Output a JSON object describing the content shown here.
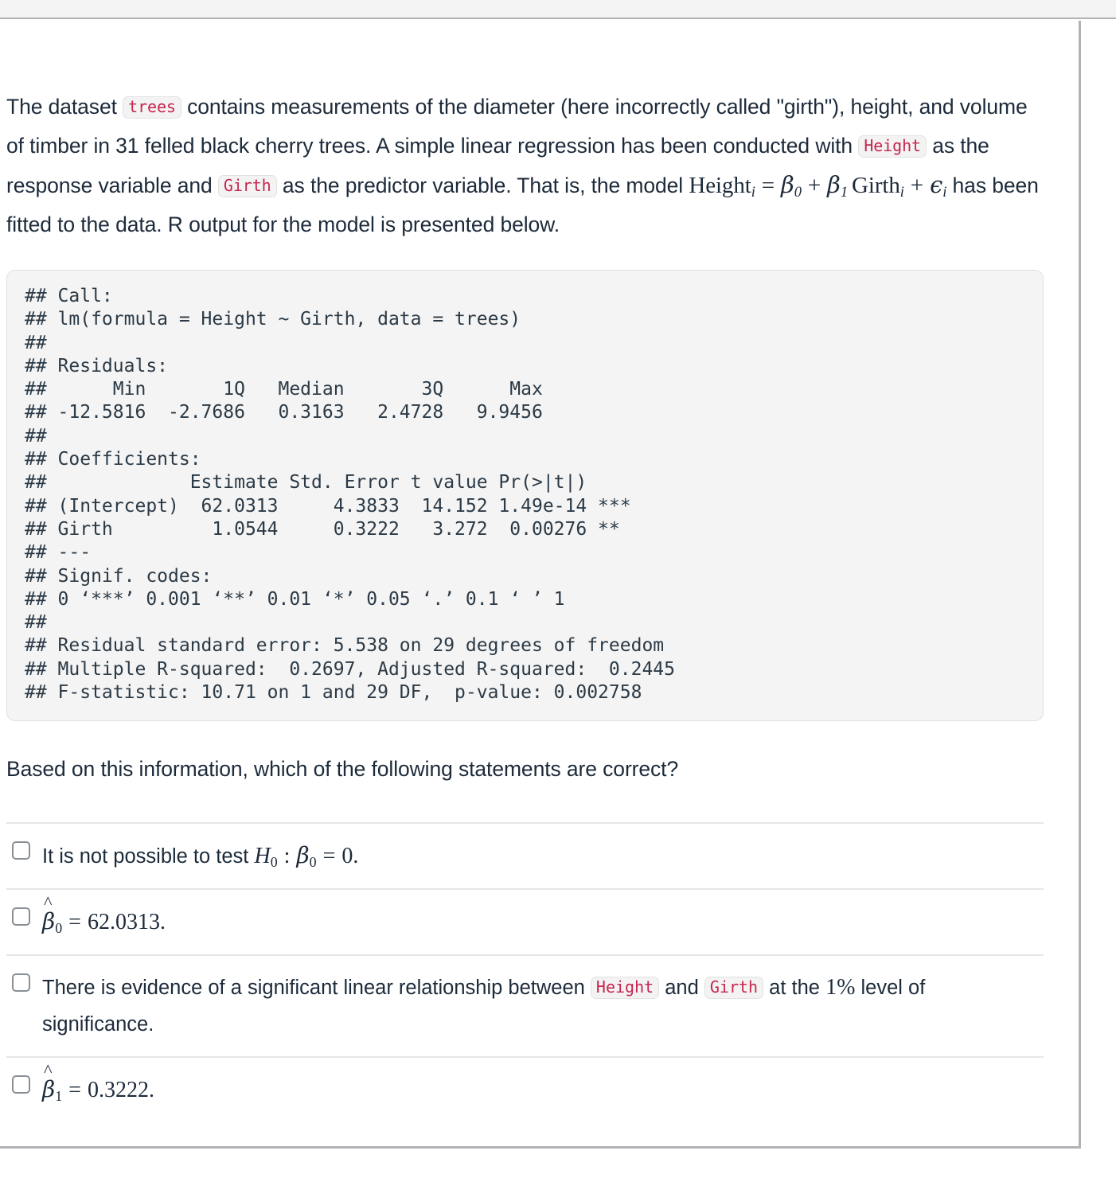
{
  "document": {
    "intro": {
      "seg1": "The dataset ",
      "code_trees": "trees",
      "seg2": " contains measurements of the diameter (here incorrectly called \"girth\"), height, and volume of timber in 31 felled black cherry trees. A simple linear regression has been conducted with ",
      "code_height": "Height",
      "seg3": " as the response variable and ",
      "code_girth": "Girth",
      "seg4": " as the predictor variable. That is, the model ",
      "seg5": " has been fitted to the data. R output for the model is presented below.",
      "model_formula": {
        "lhs": "Height",
        "lhs_sub": "i",
        "equals": "=",
        "beta0": "β",
        "beta0_sub": "0",
        "plus1": "+",
        "beta1": "β",
        "beta1_sub": "1",
        "girth": "Girth",
        "girth_sub": "i",
        "plus2": "+",
        "epsilon": "ϵ",
        "epsilon_sub": "i"
      }
    },
    "r_output": "## Call:\n## lm(formula = Height ~ Girth, data = trees)\n## \n## Residuals:\n##      Min       1Q   Median       3Q      Max \n## -12.5816  -2.7686   0.3163   2.4728   9.9456 \n## \n## Coefficients:\n##             Estimate Std. Error t value Pr(>|t|)    \n## (Intercept)  62.0313     4.3833  14.152 1.49e-14 ***\n## Girth         1.0544     0.3222   3.272  0.00276 ** \n## ---\n## Signif. codes:\n## 0 ‘***’ 0.001 ‘**’ 0.01 ‘*’ 0.05 ‘.’ 0.1 ‘ ’ 1\n## \n## Residual standard error: 5.538 on 29 degrees of freedom\n## Multiple R-squared:  0.2697, Adjusted R-squared:  0.2445 \n## F-statistic: 10.71 on 1 and 29 DF,  p-value: 0.002758",
    "r_output_values": {
      "call": "lm(formula = Height ~ Girth, data = trees)",
      "residuals": {
        "headers": [
          "Min",
          "1Q",
          "Median",
          "3Q",
          "Max"
        ],
        "values": [
          "-12.5816",
          "-2.7686",
          "0.3163",
          "2.4728",
          "9.9456"
        ]
      },
      "coefficients": {
        "headers": [
          "",
          "Estimate",
          "Std. Error",
          "t value",
          "Pr(>|t|)",
          ""
        ],
        "rows": [
          [
            "(Intercept)",
            "62.0313",
            "4.3833",
            "14.152",
            "1.49e-14",
            "***"
          ],
          [
            "Girth",
            "1.0544",
            "0.3222",
            "3.272",
            "0.00276",
            "**"
          ]
        ]
      },
      "signif_codes": "0 ‘***’ 0.001 ‘**’ 0.01 ‘*’ 0.05 ‘.’ 0.1 ‘ ’ 1",
      "residual_standard_error": "5.538",
      "residual_df": "29",
      "multiple_r_squared": "0.2697",
      "adjusted_r_squared": "0.2445",
      "f_statistic": "10.71",
      "f_df1": "1",
      "f_df2": "29",
      "p_value": "0.002758"
    },
    "question": "Based on this information, which of the following statements are correct?",
    "options": [
      {
        "id": "option-1",
        "prefix": "It is not possible to test ",
        "math": {
          "H": "H",
          "H_sub": "0",
          "colon": ":",
          "beta": "β",
          "beta_sub": "0",
          "equals": "=",
          "value": "0."
        },
        "suffix": ""
      },
      {
        "id": "option-2",
        "prefix": "",
        "math": {
          "hat": "^",
          "beta": "β",
          "beta_sub": "0",
          "equals": "=",
          "value": "62.0313."
        },
        "suffix": ""
      },
      {
        "id": "option-3",
        "seg1": "There is evidence of a significant linear relationship between ",
        "code_height": "Height",
        "seg2": " and ",
        "code_girth": "Girth",
        "seg3": " at the ",
        "percent": "1%",
        "seg4": " level of significance."
      },
      {
        "id": "option-4",
        "prefix": "",
        "math": {
          "hat": "^",
          "beta": "β",
          "beta_sub": "1",
          "equals": "=",
          "value": "0.3222."
        },
        "suffix": ""
      }
    ]
  },
  "colors": {
    "text": "#1c2a3a",
    "code_text": "#c7254e",
    "code_bg": "#f3f3f3",
    "block_bg": "#f4f4f4",
    "divider": "#e6e6e6",
    "frame_border": "#b0b2b5"
  }
}
